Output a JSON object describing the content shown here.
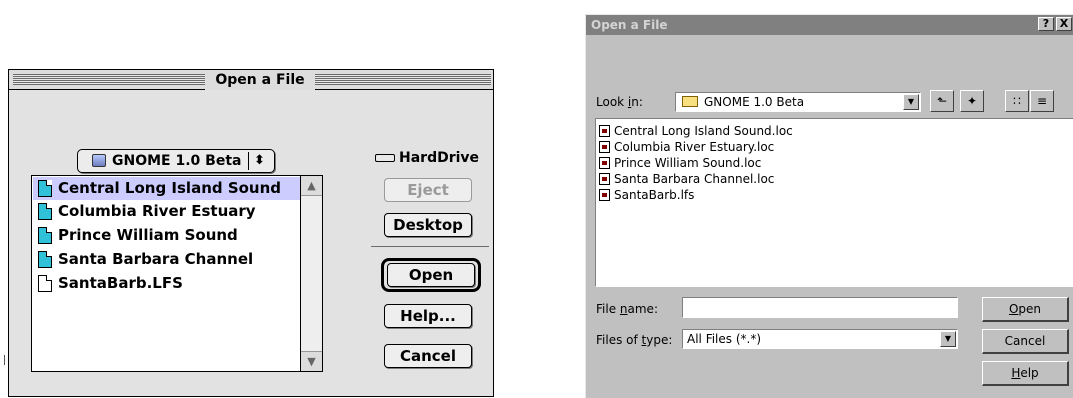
{
  "mac_dialog": {
    "title": "Open a File",
    "folder_popup": {
      "label": "GNOME 1.0 Beta",
      "arrows": "⬍"
    },
    "files": [
      {
        "name": "Central Long Island Sound",
        "type": "data",
        "selected": true
      },
      {
        "name": "Columbia River Estuary",
        "type": "data",
        "selected": false
      },
      {
        "name": "Prince William Sound",
        "type": "data",
        "selected": false
      },
      {
        "name": "Santa Barbara Channel",
        "type": "data",
        "selected": false
      },
      {
        "name": "SantaBarb.LFS",
        "type": "plain",
        "selected": false
      }
    ],
    "drive_label": "HardDrive",
    "buttons": {
      "eject": "Eject",
      "desktop": "Desktop",
      "open": "Open",
      "help": "Help...",
      "cancel": "Cancel"
    },
    "scroll_up": "▲",
    "scroll_down": "▼"
  },
  "win_dialog": {
    "title": "Open a File",
    "help_btn": "?",
    "close_btn": "X",
    "look_in": {
      "prefix": "Look ",
      "mnemonic": "i",
      "suffix": "n:"
    },
    "look_in_value": "GNOME 1.0 Beta",
    "combo_arrow": "▼",
    "toolbar": {
      "up_folder": "⬑",
      "new_folder": "✦",
      "list_view": "∷",
      "details_view": "≡"
    },
    "files": [
      "Central Long Island Sound.loc",
      "Columbia River Estuary.loc",
      "Prince William Sound.loc",
      "Santa Barbara Channel.loc",
      "SantaBarb.lfs"
    ],
    "file_name_label": {
      "prefix": "File ",
      "mnemonic": "n",
      "suffix": "ame:"
    },
    "file_name_value": "",
    "files_of_type_label": {
      "prefix": "Files of ",
      "mnemonic": "t",
      "suffix": "ype:"
    },
    "files_of_type_value": "All Files (*.*)",
    "buttons": {
      "open": {
        "mnemonic": "O",
        "rest": "pen"
      },
      "cancel": "Cancel",
      "help": {
        "mnemonic": "H",
        "rest": "elp"
      }
    }
  }
}
